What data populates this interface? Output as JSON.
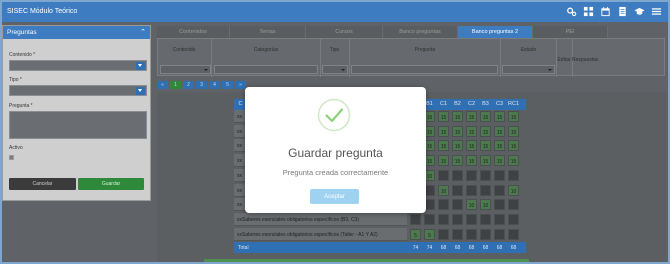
{
  "app": {
    "title": "SISEC Módulo Teórico"
  },
  "top_icons": [
    "gears-icon",
    "grid-icon",
    "calendar-icon",
    "document-icon",
    "graduation-cap-icon",
    "menu-icon"
  ],
  "left_panel": {
    "title": "Preguntas",
    "contenido_label": "Contenido *",
    "tipo_label": "Tipo *",
    "pregunta_label": "Pregunta *",
    "activo_label": "Activo",
    "cancel_label": "Cancelar",
    "save_label": "Guardar"
  },
  "tabs": [
    "Contenidos",
    "Temas",
    "Cursos",
    "Banco preguntas",
    "Banco preguntas 2",
    "PEI"
  ],
  "active_tab": 4,
  "filter_columns": [
    "Contenido",
    "Categorías",
    "Tipo",
    "Pregunta",
    "Estado",
    "Editar",
    "Respuestas"
  ],
  "pagination": [
    "«",
    "1",
    "2",
    "3",
    "4",
    "5",
    "»"
  ],
  "table": {
    "first_col_header": "C",
    "headers": [
      "3",
      "B1",
      "C1",
      "B2",
      "C2",
      "B3",
      "C3",
      "RC1"
    ],
    "rows": [
      {
        "label": "xx",
        "cells": [
          "15",
          "15",
          "15",
          "15",
          "15",
          "15",
          "15",
          "15"
        ]
      },
      {
        "label": "xx",
        "cells": [
          "15",
          "15",
          "15",
          "15",
          "15",
          "15",
          "15",
          "15"
        ]
      },
      {
        "label": "xx",
        "cells": [
          "15",
          "15",
          "15",
          "15",
          "15",
          "15",
          "15",
          "15"
        ]
      },
      {
        "label": "xx",
        "cells": [
          "15",
          "15",
          "15",
          "15",
          "15",
          "15",
          "15",
          "15"
        ]
      },
      {
        "label": "xx",
        "cells": [
          "",
          "10",
          "",
          "",
          "",
          "",
          "",
          ""
        ]
      },
      {
        "label": "xx",
        "cells": [
          "",
          "",
          "10",
          "",
          "",
          "",
          "",
          "10"
        ]
      },
      {
        "label": "xx",
        "cells": [
          "",
          "",
          "",
          "",
          "10",
          "10",
          "",
          ""
        ]
      },
      {
        "label": "xxSaberes esenciales obligatorios específicos (B3, C3)",
        "cells": [
          "",
          "",
          "",
          "",
          "",
          "",
          "",
          ""
        ]
      },
      {
        "label": "xxSaberes esenciales obligatorios específicos (Taller - A1 Y A2)",
        "cells": [
          "5",
          "5",
          "",
          "",
          "",
          "",
          "",
          ""
        ]
      }
    ],
    "total_label": "Total",
    "totals": [
      "74",
      "74",
      "68",
      "68",
      "68",
      "68",
      "68",
      "68"
    ]
  },
  "modal": {
    "title": "Guardar pregunta",
    "message": "Pregunta creada correctamente",
    "button": "Aceptar"
  }
}
